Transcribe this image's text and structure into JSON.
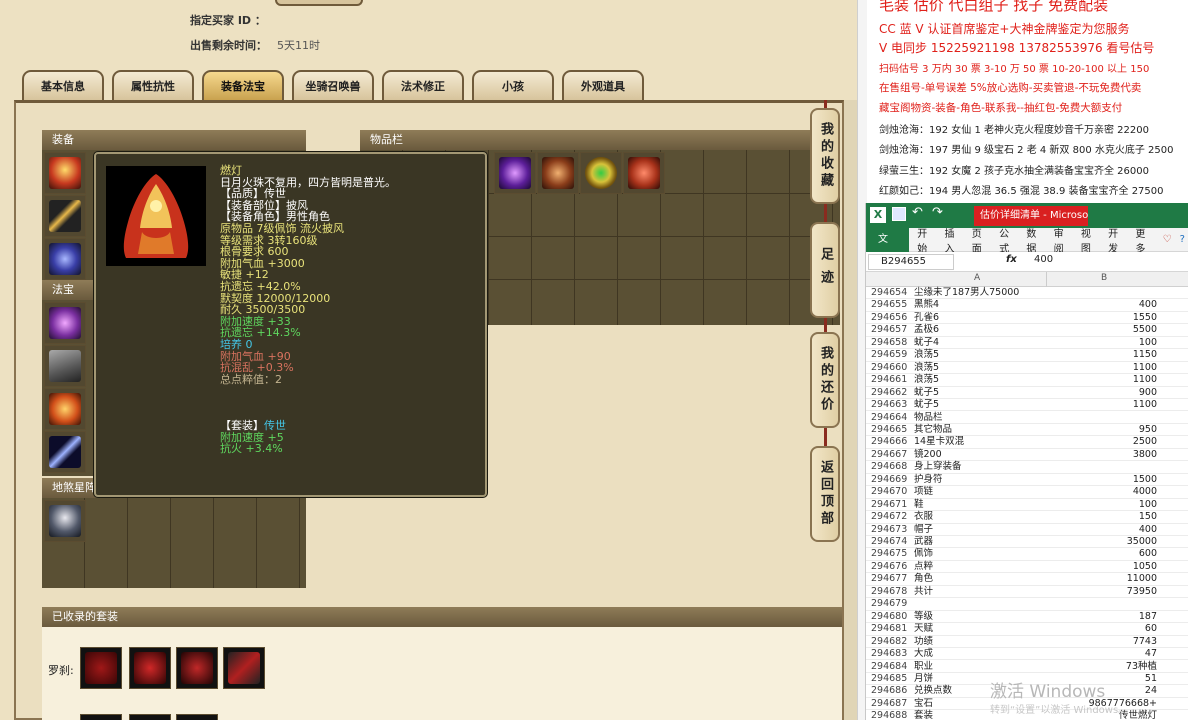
{
  "seller": {
    "buyer_label": "指定买家 ID ：",
    "buyer_value": "",
    "time_label": "出售剩余时间：",
    "time_value": "5天11时"
  },
  "tabs": [
    "基本信息",
    "属性抗性",
    "装备法宝",
    "坐骑召唤兽",
    "法术修正",
    "小孩",
    "外观道具"
  ],
  "active_tab": 2,
  "sections": {
    "equip": "装备",
    "items": "物品栏",
    "fabao": "法宝",
    "earth": "地煞星阵",
    "sets": "已收录的套装",
    "set_row_label": "罗刹:"
  },
  "side_buttons": [
    "我的收藏",
    "足迹",
    "我的还价",
    "返回顶部"
  ],
  "tooltip": {
    "name": "燃灯",
    "lines": [
      {
        "t": "日月火珠不复用，四方皆明是普光。",
        "c": "w"
      },
      {
        "t": "【品质】传世",
        "c": "w"
      },
      {
        "t": "【装备部位】披风",
        "c": "w"
      },
      {
        "t": "【装备角色】男性角色",
        "c": "w"
      },
      {
        "t": "原物品 7级佩饰 流火披风",
        "c": "y"
      },
      {
        "t": "等级需求 3转160级",
        "c": "y"
      },
      {
        "t": "根骨要求 600",
        "c": "y"
      },
      {
        "t": "附加气血 +3000",
        "c": "y"
      },
      {
        "t": "敏捷 +12",
        "c": "y"
      },
      {
        "t": "抗遗忘 +42.0%",
        "c": "y"
      },
      {
        "t": "默契度 12000/12000",
        "c": "y"
      },
      {
        "t": "耐久 3500/3500",
        "c": "y"
      },
      {
        "t": "附加速度 +33",
        "c": "g"
      },
      {
        "t": "抗遗忘 +14.3%",
        "c": "g"
      },
      {
        "t": "培养 0",
        "c": "c"
      },
      {
        "t": "附加气血 +90",
        "c": "r"
      },
      {
        "t": "抗混乱 +0.3%",
        "c": "r"
      },
      {
        "t": "总点粹值：2",
        "c": "gy"
      },
      {
        "t": "",
        "c": "w"
      },
      {
        "t": "",
        "c": "w"
      },
      {
        "t": "【套装】传世",
        "c": "mix"
      },
      {
        "t": "附加速度 +5",
        "c": "g"
      },
      {
        "t": "抗火 +3.4%",
        "c": "g"
      }
    ],
    "set_label": "【套装】",
    "set_value": "传世"
  },
  "notes": [
    {
      "t": "毛装 估价 代白组子 找子 免费配装",
      "c": "#e0201a"
    },
    {
      "t": "CC 蓝 V 认证首席鉴定+大神金牌鉴定为您服务",
      "c": "#e0201a"
    },
    {
      "t": "V 电同步 15225921198 13782553976 看号估号",
      "c": "#e0201a"
    },
    {
      "t": "扫码估号 3 万内 30 票 3-10 万 50 票 10-20-100 以上 150",
      "c": "#e0201a"
    },
    {
      "t": "在售组号-单号误差 5%放心选购-买卖管退-不玩免费代卖",
      "c": "#e0201a"
    },
    {
      "t": "藏宝阁物资-装备-角色-联系我--抽红包-免费大额支付",
      "c": "#e0201a"
    },
    {
      "t": "剑烛沧海：192 女仙 1 老神火克火程度妙音千万亲密 22200",
      "c": "#222"
    },
    {
      "t": "剑烛沧海：197 男仙 9 级宝石 2 老 4 新双 800 水克火底子 2500",
      "c": "#222"
    },
    {
      "t": "绿萤三生：192 女魔 2 孩子克水抽全满装备宝宝齐全 26000",
      "c": "#222"
    },
    {
      "t": "红颜如己：194 男人忽混 36.5 强混 38.9 装备宝宝齐全 27500",
      "c": "#222"
    }
  ],
  "excel": {
    "title": "估价详细清单 - Microsoft...",
    "menu": [
      "文件",
      "开始",
      "插入",
      "页面",
      "公式",
      "数据",
      "审阅",
      "视图",
      "开发",
      "更多"
    ],
    "cell_ref": "B294655",
    "fx": "fx",
    "formula_value": "400",
    "col_a": "A",
    "col_b": "B",
    "rows": [
      {
        "n": "294654",
        "a": "尘缘未了187男人75000",
        "b": ""
      },
      {
        "n": "294655",
        "a": "黑熊4",
        "b": "400"
      },
      {
        "n": "294656",
        "a": "孔雀6",
        "b": "1550"
      },
      {
        "n": "294657",
        "a": "孟极6",
        "b": "5500"
      },
      {
        "n": "294658",
        "a": "蚘子4",
        "b": "100"
      },
      {
        "n": "294659",
        "a": "浪荡5",
        "b": "1150"
      },
      {
        "n": "294660",
        "a": "浪荡5",
        "b": "1100"
      },
      {
        "n": "294661",
        "a": "浪荡5",
        "b": "1100"
      },
      {
        "n": "294662",
        "a": "蚘子5",
        "b": "900"
      },
      {
        "n": "294663",
        "a": "蚘子5",
        "b": "1100"
      },
      {
        "n": "294664",
        "a": "物品栏",
        "b": ""
      },
      {
        "n": "294665",
        "a": "其它物品",
        "b": "950"
      },
      {
        "n": "294666",
        "a": "14星卡双混",
        "b": "2500"
      },
      {
        "n": "294667",
        "a": "镜200",
        "b": "3800"
      },
      {
        "n": "294668",
        "a": "身上穿装备",
        "b": ""
      },
      {
        "n": "294669",
        "a": "护身符",
        "b": "1500"
      },
      {
        "n": "294670",
        "a": "项链",
        "b": "4000"
      },
      {
        "n": "294671",
        "a": "鞋",
        "b": "100"
      },
      {
        "n": "294672",
        "a": "衣服",
        "b": "150"
      },
      {
        "n": "294673",
        "a": "帽子",
        "b": "400"
      },
      {
        "n": "294674",
        "a": "武器",
        "b": "35000"
      },
      {
        "n": "294675",
        "a": "佩饰",
        "b": "600"
      },
      {
        "n": "294676",
        "a": "点粹",
        "b": "1050"
      },
      {
        "n": "294677",
        "a": "角色",
        "b": "11000"
      },
      {
        "n": "294678",
        "a": "共计",
        "b": "73950"
      },
      {
        "n": "294679",
        "a": "",
        "b": ""
      },
      {
        "n": "294680",
        "a": "等级",
        "b": "187"
      },
      {
        "n": "294681",
        "a": "天赋",
        "b": "60"
      },
      {
        "n": "294682",
        "a": "功绩",
        "b": "7743"
      },
      {
        "n": "294683",
        "a": "大成",
        "b": "47"
      },
      {
        "n": "294684",
        "a": "职业",
        "b": "73种植"
      },
      {
        "n": "294685",
        "a": "月饼",
        "b": "51"
      },
      {
        "n": "294686",
        "a": "兑换点数",
        "b": "24"
      },
      {
        "n": "294687",
        "a": "宝石",
        "b": "9867776668+"
      },
      {
        "n": "294688",
        "a": "套装",
        "b": "传世燃灯"
      }
    ]
  },
  "watermark": {
    "main": "激活 Windows",
    "sub": "转到“设置”以激活 Windows。"
  },
  "colors": {
    "panel": "#ebdfc0",
    "slot": "#5a5034",
    "accent": "#c9a24f",
    "excel": "#1f7a45",
    "notes_red": "#e0201a"
  }
}
